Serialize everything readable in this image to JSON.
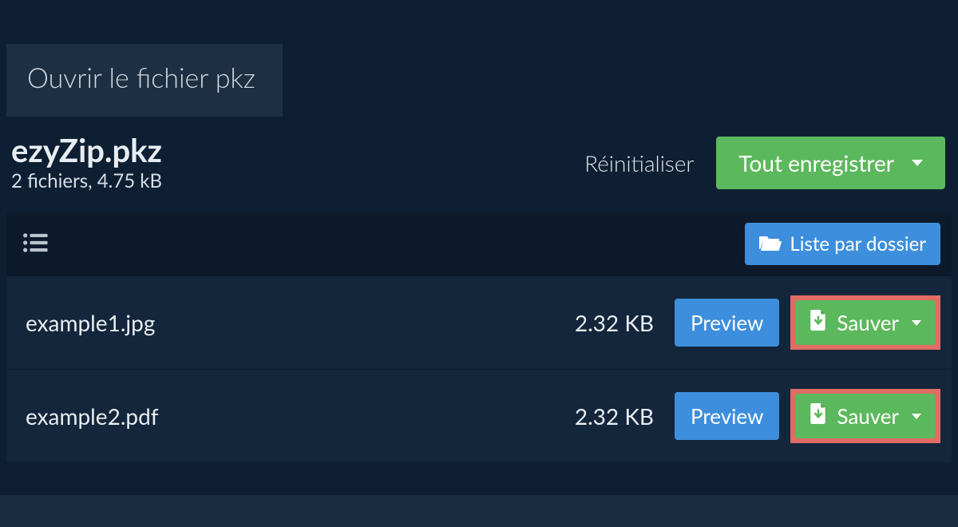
{
  "tab": {
    "label": "Ouvrir le fichier pkz"
  },
  "header": {
    "filename": "ezyZip.pkz",
    "fileinfo": "2 fichiers, 4.75 kB",
    "reset": "Réinitialiser",
    "save_all": "Tout enregistrer"
  },
  "table": {
    "folder_button": "Liste par dossier",
    "preview_label": "Preview",
    "save_label": "Sauver",
    "rows": [
      {
        "name": "example1.jpg",
        "size": "2.32 KB"
      },
      {
        "name": "example2.pdf",
        "size": "2.32 KB"
      }
    ]
  }
}
